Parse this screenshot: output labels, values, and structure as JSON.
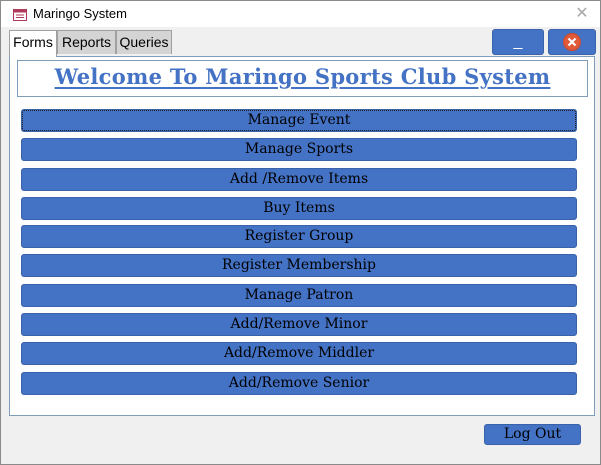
{
  "window": {
    "title": "Maringo System",
    "icon": "form-icon",
    "close_glyph": "✕"
  },
  "tabs": [
    {
      "label": "Forms",
      "active": true
    },
    {
      "label": "Reports",
      "active": false
    },
    {
      "label": "Queries",
      "active": false
    }
  ],
  "controls": {
    "minimize_label": "_",
    "close_icon": "close-circle-icon"
  },
  "header": {
    "welcome": "Welcome To Maringo Sports Club System"
  },
  "menu": [
    {
      "label": "Manage Event",
      "focused": true
    },
    {
      "label": "Manage Sports"
    },
    {
      "label": "Add /Remove Items"
    },
    {
      "label": "Buy Items"
    },
    {
      "label": "Register Group"
    },
    {
      "label": "Register Membership"
    },
    {
      "label": "Manage Patron"
    },
    {
      "label": "Add/Remove Minor"
    },
    {
      "label": "Add/Remove Middler"
    },
    {
      "label": "Add/Remove Senior"
    }
  ],
  "footer": {
    "logout_label": "Log Out"
  },
  "colors": {
    "accent": "#4472c4",
    "heading": "#4472c4",
    "close_badge": "#e05a3a"
  }
}
